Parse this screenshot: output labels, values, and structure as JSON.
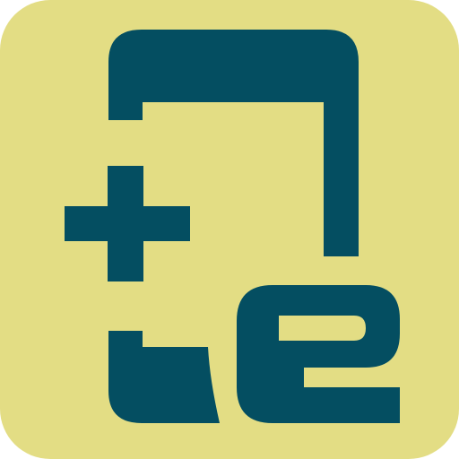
{
  "icon": {
    "name": "add-e-document-icon",
    "description_visible_text": "",
    "colors": {
      "background": "#e3dd84",
      "foreground": "#044e61"
    }
  }
}
